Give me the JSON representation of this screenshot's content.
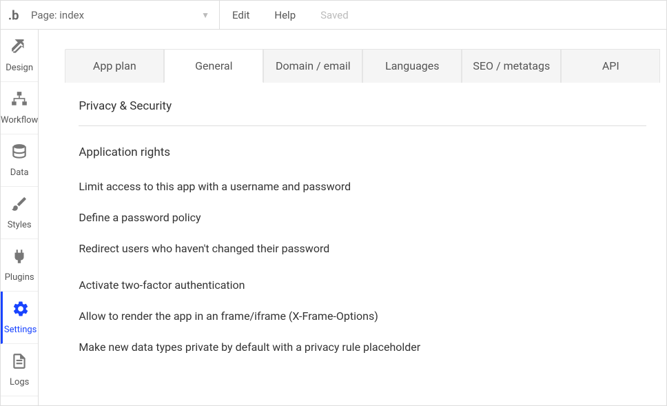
{
  "topbar": {
    "page_label": "Page: index",
    "edit": "Edit",
    "help": "Help",
    "saved": "Saved"
  },
  "sidebar": {
    "items": [
      {
        "label": "Design"
      },
      {
        "label": "Workflow"
      },
      {
        "label": "Data"
      },
      {
        "label": "Styles"
      },
      {
        "label": "Plugins"
      },
      {
        "label": "Settings"
      },
      {
        "label": "Logs"
      }
    ]
  },
  "tabs": [
    {
      "label": "App plan"
    },
    {
      "label": "General"
    },
    {
      "label": "Domain / email"
    },
    {
      "label": "Languages"
    },
    {
      "label": "SEO / metatags"
    },
    {
      "label": "API"
    }
  ],
  "section": {
    "title": "Privacy & Security",
    "subhead": "Application rights",
    "options": [
      "Limit access to this app with a username and password",
      "Define a password policy",
      "Redirect users who haven't changed their password",
      "Activate two-factor authentication",
      "Allow to render the app in an frame/iframe (X-Frame-Options)",
      "Make new data types private by default with a privacy rule placeholder"
    ]
  }
}
